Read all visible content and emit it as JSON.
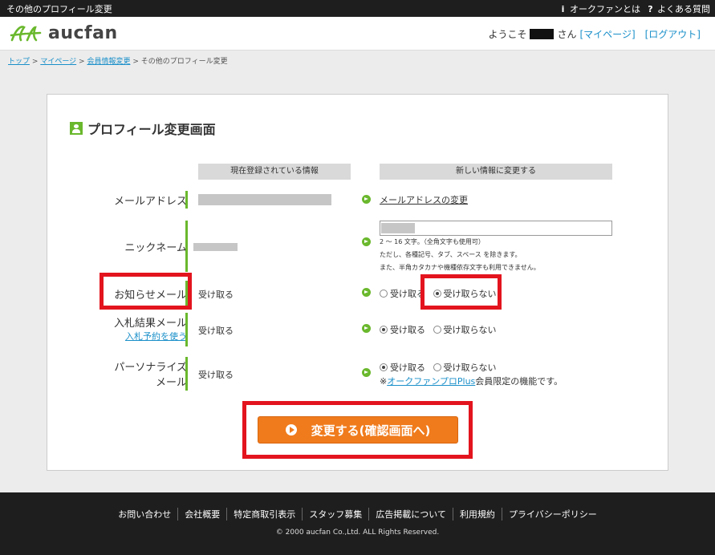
{
  "topbar": {
    "title": "その他のプロフィール変更",
    "about_label": "オークファンとは",
    "faq_label": "よくある質問"
  },
  "header": {
    "logo_text": "aucfan",
    "welcome_prefix": "ようこそ",
    "welcome_suffix": "さん",
    "mypage_link": "[マイページ]",
    "logout_link": "[ログアウト]"
  },
  "breadcrumb": {
    "items": [
      "トップ",
      "マイページ",
      "会員情報変更"
    ],
    "separator": ">",
    "current": "その他のプロフィール変更"
  },
  "panel": {
    "title": "プロフィール変更画面",
    "col_current": "現在登録されている情報",
    "col_new": "新しい情報に変更する"
  },
  "rows": {
    "email": {
      "label": "メールアドレス",
      "change_link": "メールアドレスの変更"
    },
    "nickname": {
      "label": "ニックネーム",
      "hint1": "2 ～ 16 文字。（全角文字も使用可）",
      "hint2": "ただし、各種記号、タブ、スペース を除きます。",
      "hint3": "また、半角カタカナや機種依存文字も利用できません。"
    },
    "notice": {
      "label": "お知らせメール",
      "current": "受け取る",
      "opt_receive": "受け取る",
      "opt_reject": "受け取らない",
      "selected": "reject"
    },
    "bid": {
      "label": "入札結果メール",
      "sublink": "入札予約を使う",
      "current": "受け取る",
      "opt_receive": "受け取る",
      "opt_reject": "受け取らない",
      "selected": "receive"
    },
    "personalize": {
      "label_line1": "パーソナライズ",
      "label_line2": "メール",
      "current": "受け取る",
      "opt_receive": "受け取る",
      "opt_reject": "受け取らない",
      "selected": "receive",
      "note_prefix": "※",
      "note_link": "オークファンプロPlus",
      "note_suffix": "会員限定の機能です。"
    }
  },
  "submit": {
    "label": "変更する(確認画面へ)"
  },
  "footer": {
    "links": [
      "お問い合わせ",
      "会社概要",
      "特定商取引表示",
      "スタッフ募集",
      "広告掲載について",
      "利用規約",
      "プライバシーポリシー"
    ],
    "copyright": "© 2000 aucfan Co.,Ltd. ALL Rights Reserved."
  },
  "colors": {
    "accent_green": "#6ab82d",
    "button_orange": "#f07b1c",
    "highlight_red": "#e3141e",
    "link_blue": "#1a8fc9"
  }
}
